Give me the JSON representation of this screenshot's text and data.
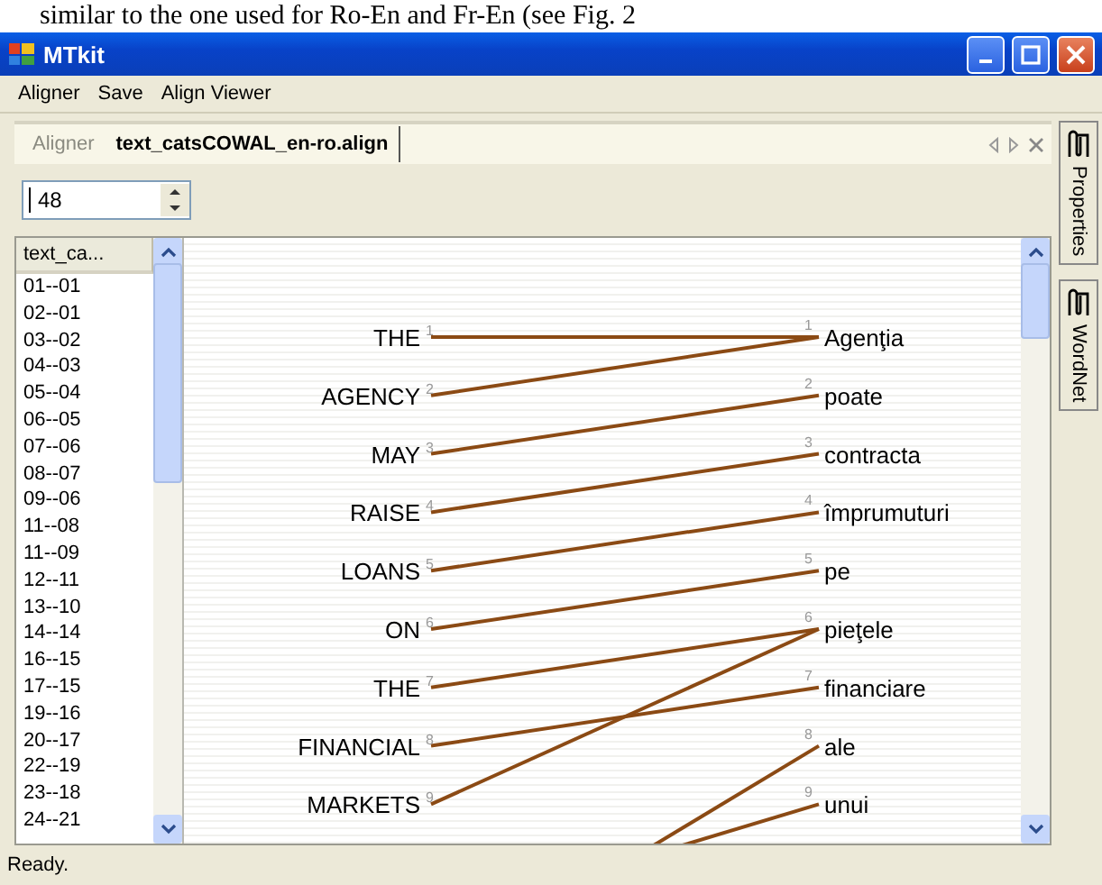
{
  "page_caption": "similar to the one used for Ro-En and Fr-En (see Fig. 2",
  "window": {
    "title": "MTkit"
  },
  "menu": [
    "Aligner",
    "Save",
    "Align Viewer"
  ],
  "tabs": [
    {
      "label": "Aligner",
      "selected": false
    },
    {
      "label": "text_catsCOWAL_en-ro.align",
      "selected": true
    }
  ],
  "sentence_spinner": {
    "value": "48"
  },
  "sentence_list": {
    "header": "text_ca...",
    "items": [
      "01--01",
      "02--01",
      "03--02",
      "04--03",
      "05--04",
      "06--05",
      "07--06",
      "08--07",
      "09--06",
      "11--08",
      "11--09",
      "12--11",
      "13--10",
      "14--14",
      "16--15",
      "17--15",
      "19--16",
      "20--17",
      "22--19",
      "23--18",
      "24--21"
    ]
  },
  "alignment": {
    "source": [
      {
        "word": "THE",
        "index": "1"
      },
      {
        "word": "AGENCY",
        "index": "2"
      },
      {
        "word": "MAY",
        "index": "3"
      },
      {
        "word": "RAISE",
        "index": "4"
      },
      {
        "word": "LOANS",
        "index": "5"
      },
      {
        "word": "ON",
        "index": "6"
      },
      {
        "word": "THE",
        "index": "7"
      },
      {
        "word": "FINANCIAL",
        "index": "8"
      },
      {
        "word": "MARKETS",
        "index": "9"
      }
    ],
    "target": [
      {
        "word": "Agenţia",
        "index": "1"
      },
      {
        "word": "poate",
        "index": "2"
      },
      {
        "word": "contracta",
        "index": "3"
      },
      {
        "word": "împrumuturi",
        "index": "4"
      },
      {
        "word": "pe",
        "index": "5"
      },
      {
        "word": "pieţele",
        "index": "6"
      },
      {
        "word": "financiare",
        "index": "7"
      },
      {
        "word": "ale",
        "index": "8"
      },
      {
        "word": "unui",
        "index": "9"
      }
    ]
  },
  "side_tabs": [
    "Properties",
    "WordNet"
  ],
  "status_bar": "Ready."
}
